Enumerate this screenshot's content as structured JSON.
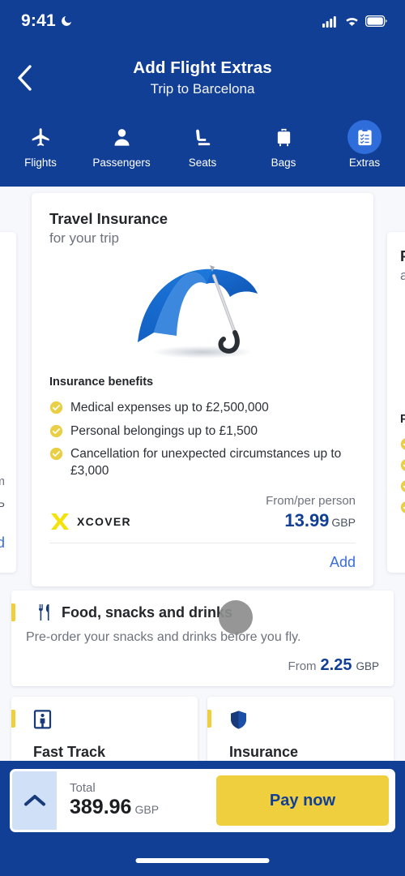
{
  "status_bar": {
    "time": "9:41",
    "moon_icon": "crescent-moon-icon",
    "signal_icon": "cellular-signal-icon",
    "wifi_icon": "wifi-icon",
    "battery_icon": "battery-full-icon"
  },
  "header": {
    "back_icon": "chevron-left-icon",
    "title": "Add Flight Extras",
    "subtitle": "Trip to Barcelona"
  },
  "tabs": [
    {
      "label": "Flights",
      "icon": "airplane-icon",
      "active": false
    },
    {
      "label": "Passengers",
      "icon": "person-icon",
      "active": false
    },
    {
      "label": "Seats",
      "icon": "seat-icon",
      "active": false
    },
    {
      "label": "Bags",
      "icon": "suitcase-icon",
      "active": false
    },
    {
      "label": "Extras",
      "icon": "clipboard-checklist-icon",
      "active": true
    }
  ],
  "insurance_card": {
    "title": "Travel Insurance",
    "subtitle": "for your trip",
    "illustration": "blue-umbrella-illustration",
    "benefits_heading": "Insurance benefits",
    "benefits": [
      "Medical expenses up to £2,500,000",
      "Personal belongings up to £1,500",
      "Cancellation for unexpected circumstances up to £3,000"
    ],
    "provider_logo": "xcover-logo",
    "provider_name": "XCOVER",
    "price_label": "From/per person",
    "price_amount": "13.99",
    "price_currency": "GBP",
    "add_label": "Add"
  },
  "side_card_left": {
    "from_fragment": "om",
    "currency_fragment": "BP",
    "add_fragment": "dd"
  },
  "side_card_right": {
    "title_fragment": "Pa",
    "subtitle_fragment": "at",
    "benefits_heading_fragment": "Pa",
    "check_count": 4
  },
  "food_card": {
    "icon": "fork-knife-icon",
    "title": "Food, snacks and drinks",
    "description": "Pre-order your snacks and drinks before you fly.",
    "price_label": "From",
    "price_amount": "2.25",
    "price_currency": "GBP"
  },
  "extra_cards": [
    {
      "title": "Fast Track",
      "icon": "fast-track-gate-icon"
    },
    {
      "title": "Insurance",
      "icon": "shield-icon"
    }
  ],
  "bottom_bar": {
    "expand_icon": "chevron-up-icon",
    "total_label": "Total",
    "total_amount": "389.96",
    "total_currency": "GBP",
    "pay_label": "Pay now"
  },
  "colors": {
    "brand_blue": "#123f96",
    "accent_yellow": "#f0cf3e",
    "link_blue": "#3a6fd8",
    "check_yellow": "#e8cf45",
    "page_bg": "#f7f8fc"
  }
}
